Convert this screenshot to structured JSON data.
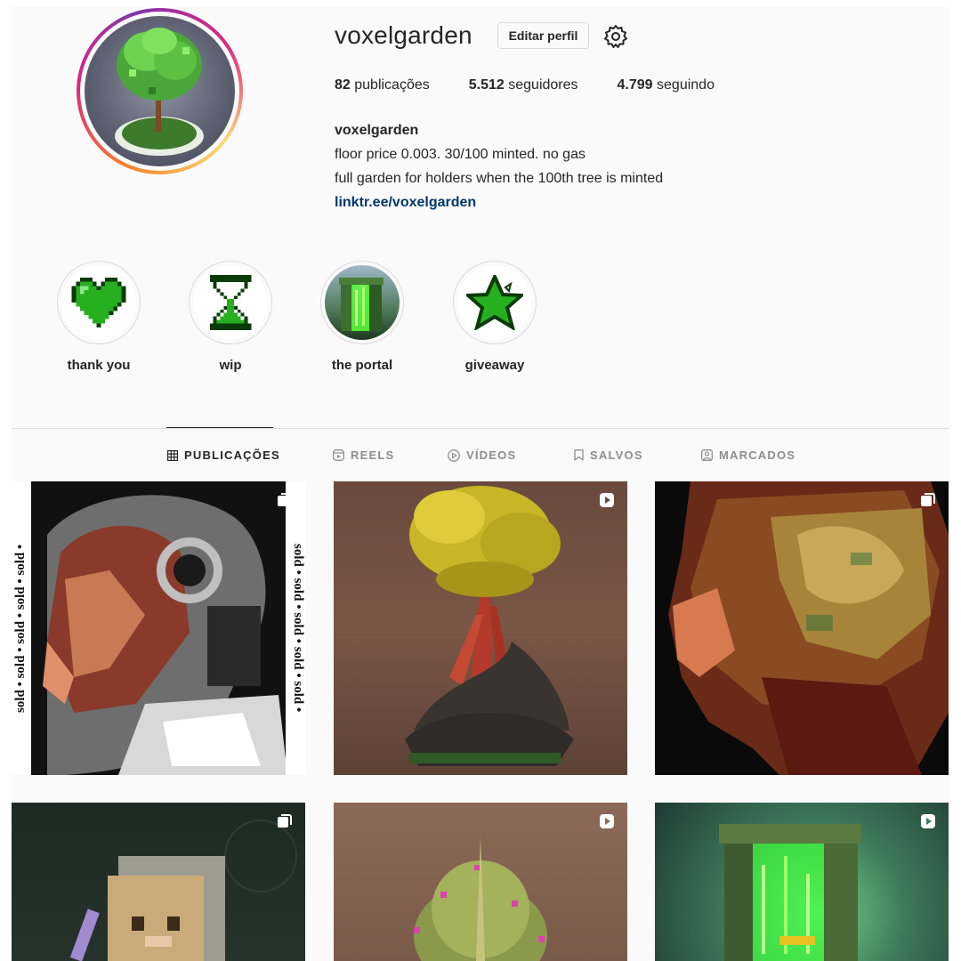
{
  "profile": {
    "username": "voxelgarden",
    "edit_label": "Editar perfil",
    "stats": {
      "posts_count": "82",
      "posts_label": "publicações",
      "followers_count": "5.512",
      "followers_label": "seguidores",
      "following_count": "4.799",
      "following_label": "seguindo"
    },
    "bio": {
      "name": "voxelgarden",
      "line1": "floor price 0.003. 30/100 minted. no gas",
      "line2": "full garden for holders when the 100th tree is minted",
      "link": "linktr.ee/voxelgarden"
    }
  },
  "highlights": [
    {
      "label": "thank you",
      "icon": "pixel-heart-icon"
    },
    {
      "label": "wip",
      "icon": "hourglass-icon"
    },
    {
      "label": "the portal",
      "icon": "portal-thumbnail"
    },
    {
      "label": "giveaway",
      "icon": "pixel-star-icon"
    }
  ],
  "tabs": [
    {
      "label": "PUBLICAÇÕES",
      "icon": "grid-icon",
      "active": true
    },
    {
      "label": "REELS",
      "icon": "reels-icon",
      "active": false
    },
    {
      "label": "VÍDEOS",
      "icon": "play-circle-icon",
      "active": false
    },
    {
      "label": "SALVOS",
      "icon": "bookmark-icon",
      "active": false
    },
    {
      "label": "MARCADOS",
      "icon": "tagged-icon",
      "active": false
    }
  ],
  "posts": [
    {
      "type": "carousel",
      "border_text": "sold • sold • sold • sold • sold •"
    },
    {
      "type": "reel"
    },
    {
      "type": "carousel"
    },
    {
      "type": "carousel"
    },
    {
      "type": "reel"
    },
    {
      "type": "reel"
    }
  ],
  "colors": {
    "link": "#00376b",
    "text": "#262626",
    "muted": "#8e8e8e",
    "border": "#dbdbdb",
    "pixel_green": "#22a81c"
  }
}
